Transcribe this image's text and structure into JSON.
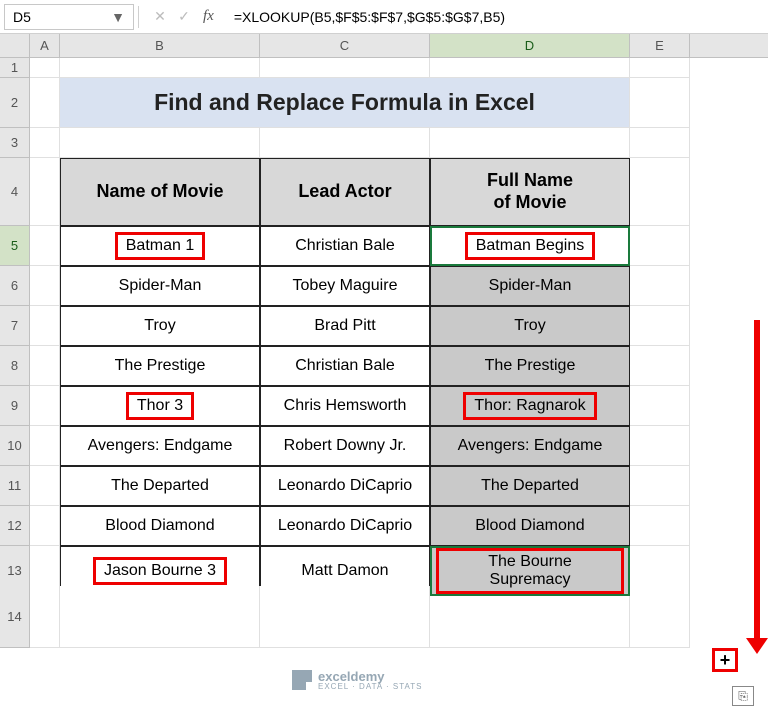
{
  "name_box": "D5",
  "formula": "=XLOOKUP(B5,$F$5:$F$7,$G$5:$G$7,B5)",
  "columns": [
    "",
    "A",
    "B",
    "C",
    "D",
    "E"
  ],
  "active_col_index": 4,
  "title": "Find and Replace Formula in Excel",
  "headers": {
    "b": "Name of Movie",
    "c": "Lead Actor",
    "d": "Full Name\nof Movie"
  },
  "rows": [
    {
      "n": "5",
      "b": "Batman 1",
      "c": "Christian Bale",
      "d": "Batman Begins",
      "hl_b": true,
      "hl_d": true,
      "sel_top": true
    },
    {
      "n": "6",
      "b": "Spider-Man",
      "c": "Tobey Maguire",
      "d": "Spider-Man"
    },
    {
      "n": "7",
      "b": "Troy",
      "c": "Brad Pitt",
      "d": "Troy"
    },
    {
      "n": "8",
      "b": "The Prestige",
      "c": "Christian Bale",
      "d": "The Prestige"
    },
    {
      "n": "9",
      "b": "Thor 3",
      "c": "Chris Hemsworth",
      "d": "Thor: Ragnarok",
      "hl_b": true,
      "hl_d": true
    },
    {
      "n": "10",
      "b": "Avengers: Endgame",
      "c": "Robert Downy Jr.",
      "d": "Avengers: Endgame"
    },
    {
      "n": "11",
      "b": "The Departed",
      "c": "Leonardo DiCaprio",
      "d": "The Departed"
    },
    {
      "n": "12",
      "b": "Blood Diamond",
      "c": "Leonardo DiCaprio",
      "d": "Blood Diamond"
    },
    {
      "n": "13",
      "b": "Jason Bourne 3",
      "c": "Matt Damon",
      "d": "The Bourne Supremacy",
      "hl_b": true,
      "hl_d": true,
      "fill_end": true
    }
  ],
  "watermark": {
    "brand": "exceldemy",
    "tag": "EXCEL · DATA · STATS"
  },
  "fill_handle_glyph": "+",
  "autofill_icon": "⎘",
  "chart_data": {
    "type": "table",
    "title": "Find and Replace Formula in Excel",
    "columns": [
      "Name of Movie",
      "Lead Actor",
      "Full Name of Movie"
    ],
    "rows": [
      [
        "Batman 1",
        "Christian Bale",
        "Batman Begins"
      ],
      [
        "Spider-Man",
        "Tobey Maguire",
        "Spider-Man"
      ],
      [
        "Troy",
        "Brad Pitt",
        "Troy"
      ],
      [
        "The Prestige",
        "Christian Bale",
        "The Prestige"
      ],
      [
        "Thor 3",
        "Chris Hemsworth",
        "Thor: Ragnarok"
      ],
      [
        "Avengers: Endgame",
        "Robert Downy Jr.",
        "Avengers: Endgame"
      ],
      [
        "The Departed",
        "Leonardo DiCaprio",
        "The Departed"
      ],
      [
        "Blood Diamond",
        "Leonardo DiCaprio",
        "Blood Diamond"
      ],
      [
        "Jason Bourne 3",
        "Matt Damon",
        "The Bourne Supremacy"
      ]
    ]
  }
}
